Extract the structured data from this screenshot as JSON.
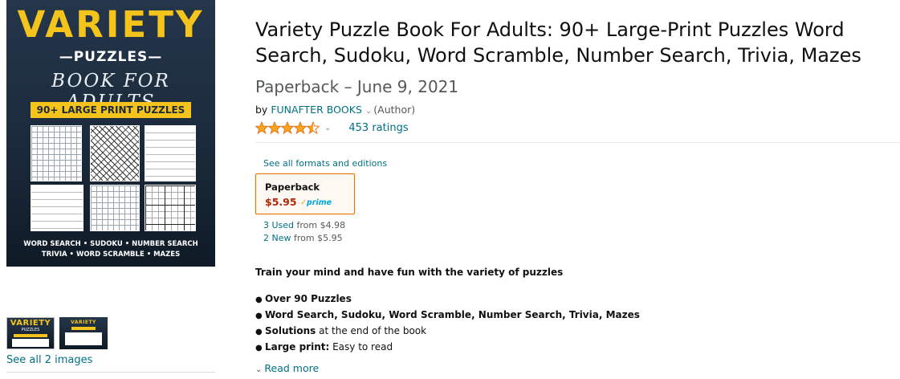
{
  "cover": {
    "title": "VARIETY",
    "subtitle": "—PUZZLES—",
    "script": "BOOK FOR ADULTS",
    "banner": "90+ LARGE PRINT PUZZLES",
    "footer_line1": "WORD SEARCH • SUDOKU • NUMBER SEARCH",
    "footer_line2": "TRIVIA • WORD SCRAMBLE • MAZES"
  },
  "thumbnails": {
    "t1_title": "VARIETY",
    "t1_sub": "PUZZLES",
    "t2_title": "VARIETY",
    "see_all": "See all 2 images"
  },
  "product": {
    "title": "Variety Puzzle Book For Adults: 90+ Large-Print Puzzles Word Search, Sudoku, Word Scramble, Number Search, Trivia, Mazes",
    "format_date": "Paperback – June 9, 2021",
    "by_prefix": "by",
    "author": "FUNAFTER BOOKS",
    "role": "(Author)",
    "rating": 4.5,
    "ratings_count": "453 ratings"
  },
  "formats": {
    "see_all_link": "See all formats and editions",
    "format_name": "Paperback",
    "price": "$5.95",
    "prime": "prime",
    "used_link": "3 Used",
    "used_from": " from $4.98",
    "new_link": "2 New",
    "new_from": " from $5.95"
  },
  "description": {
    "headline": "Train your mind and have fun with the variety of puzzles",
    "bullets": [
      {
        "bold": "Over 90 Puzzles",
        "text": ""
      },
      {
        "bold": "Word Search, Sudoku, Word Scramble, Number Search, Trivia, Mazes",
        "text": ""
      },
      {
        "bold": "Solutions",
        "text": " at the end of the book"
      },
      {
        "bold": "Large print:",
        "text": " Easy to read"
      }
    ],
    "read_more": "Read more"
  },
  "colors": {
    "link": "#007185",
    "price": "#b12704",
    "star": "#ffa41c",
    "cover_yellow": "#f4c41c",
    "cover_bg": "#1b2a3b"
  }
}
